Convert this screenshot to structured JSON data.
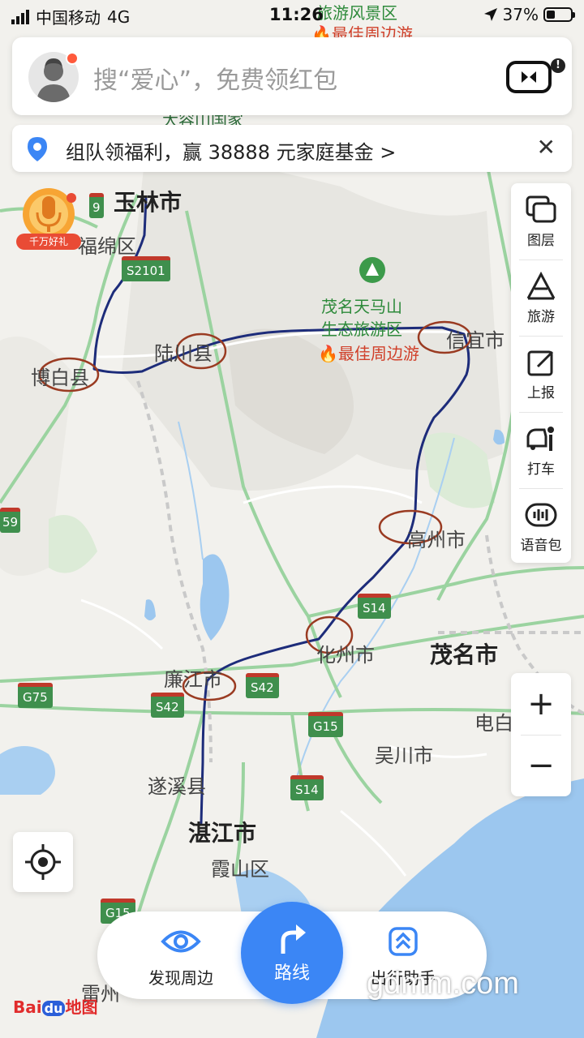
{
  "status_bar": {
    "carrier": "中国移动",
    "network": "4G",
    "time": "11:26",
    "battery_percent": "37%",
    "battery_level": 0.37
  },
  "search": {
    "placeholder": "搜“爱心”，免费领红包"
  },
  "banner": {
    "text": "组队领福利，赢 38888 元家庭基金 >"
  },
  "promo": {
    "tag": "千万好礼"
  },
  "toolbar": {
    "items": [
      {
        "label": "图层",
        "icon": "layers-icon"
      },
      {
        "label": "旅游",
        "icon": "travel-icon"
      },
      {
        "label": "上报",
        "icon": "report-icon"
      },
      {
        "label": "打车",
        "icon": "taxi-icon"
      },
      {
        "label": "语音包",
        "icon": "voice-pack-icon"
      }
    ]
  },
  "zoom": {
    "in_label": "+",
    "out_label": "−"
  },
  "bottom_bar": {
    "discover": "发现周边",
    "route": "路线",
    "assistant": "出行助手"
  },
  "logo": {
    "bai": "Bai",
    "du": "du",
    "map": "地图"
  },
  "watermark": "gdmm.com",
  "map_labels": {
    "yulin": "玉林市",
    "fumian": "福绵区",
    "bobai": "博白县",
    "luchuan": "陆川县",
    "tianmashan": "茂名天马山",
    "tianmashan2": "生态旅游区",
    "best_trip": "最佳周边游",
    "scenic_top": "旅游风景区",
    "best_trip_top": "最佳周边游",
    "dagu": "大容山国家",
    "xinyi": "信宜市",
    "gaozhou": "高州市",
    "huazhou": "化州市",
    "maoming": "茂名市",
    "lianjiang": "廉江市",
    "dianbai": "电白",
    "wuchuan": "吴川市",
    "suixi": "遂溪县",
    "zhanjiang": "湛江市",
    "xiashan": "霞山区",
    "leizhou": "雷州"
  },
  "road_shields": {
    "s2101": "S2101",
    "g9": "9",
    "g59": "59",
    "s14a": "S14",
    "s42a": "S42",
    "s42b": "S42",
    "g75": "G75",
    "g15a": "G15",
    "s14b": "S14",
    "g15b": "G15"
  },
  "colors": {
    "accent": "#3b86f5",
    "route_ink": "#1d2c7a",
    "circle_ink": "#9a3b22",
    "water": "#9cc7ef",
    "land": "#f1f0ec"
  }
}
